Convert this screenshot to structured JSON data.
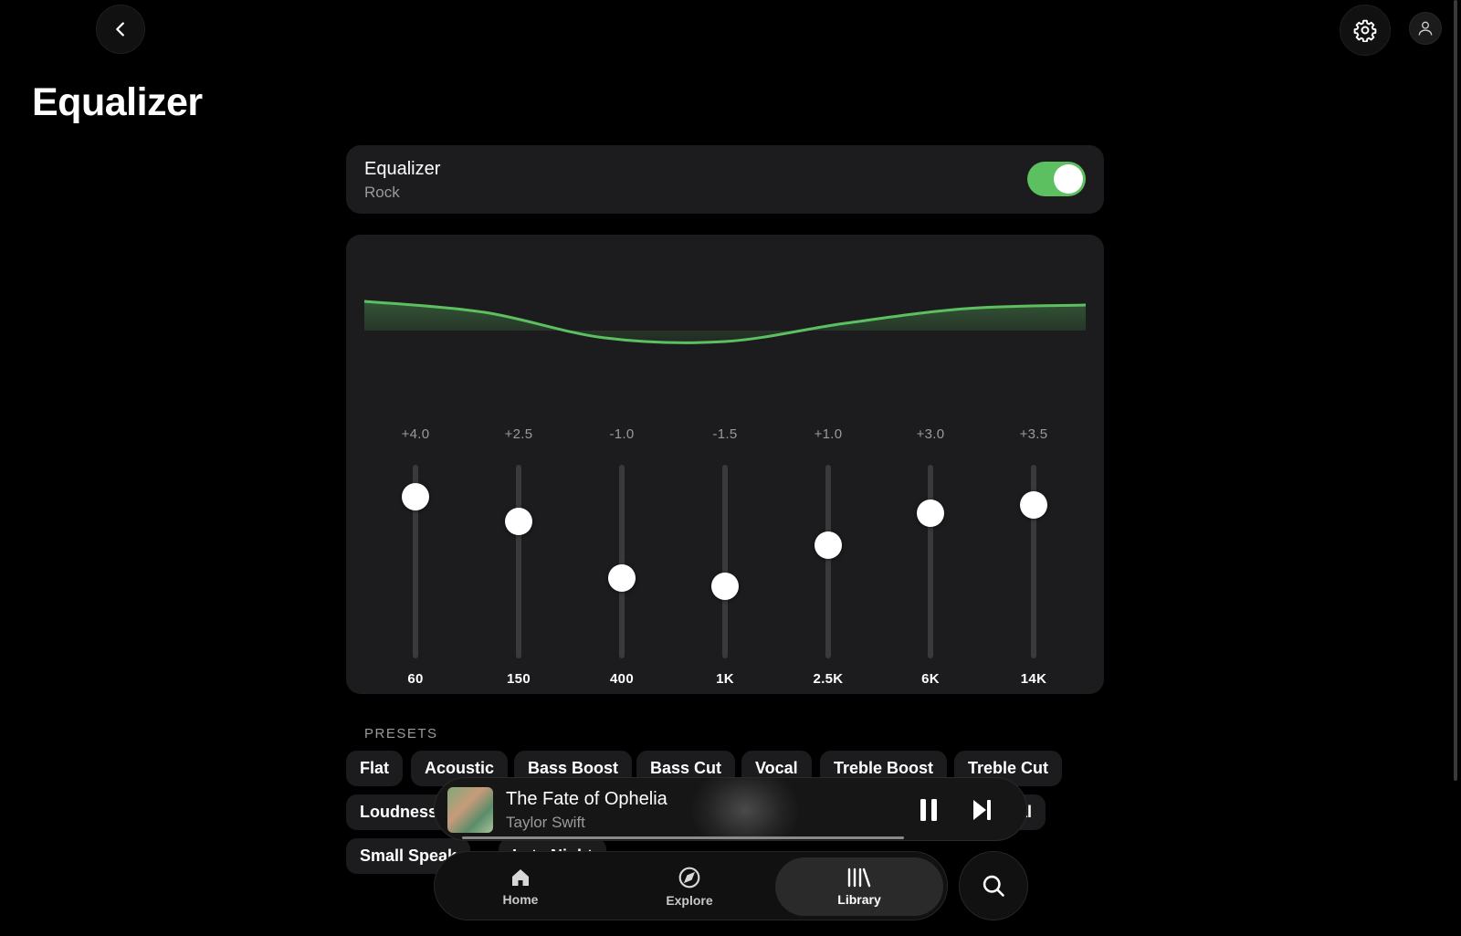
{
  "header": {
    "title": "Equalizer",
    "back_icon": "chevron-left-icon",
    "settings_icon": "gear-icon",
    "profile_icon": "user-icon"
  },
  "equalizer": {
    "card_title": "Equalizer",
    "preset_name": "Rock",
    "enabled": true,
    "accent_color": "#5cc060",
    "range_db": [
      -6,
      6
    ],
    "bands": [
      {
        "freq": "60",
        "value": "+4.0",
        "db": 4.0
      },
      {
        "freq": "150",
        "value": "+2.5",
        "db": 2.5
      },
      {
        "freq": "400",
        "value": "-1.0",
        "db": -1.0
      },
      {
        "freq": "1K",
        "value": "-1.5",
        "db": -1.5
      },
      {
        "freq": "2.5K",
        "value": "+1.0",
        "db": 1.0
      },
      {
        "freq": "6K",
        "value": "+3.0",
        "db": 3.0
      },
      {
        "freq": "14K",
        "value": "+3.5",
        "db": 3.5
      }
    ]
  },
  "presets": {
    "heading": "PRESETS",
    "items": [
      "Flat",
      "Acoustic",
      "Bass Boost",
      "Bass Cut",
      "Vocal",
      "Treble Boost",
      "Treble Cut",
      "Loudness",
      "al",
      "Small Speak",
      "Late Night"
    ]
  },
  "now_playing": {
    "title": "The Fate of Ophelia",
    "artist": "Taylor Swift",
    "progress": 0.82,
    "pause_icon": "pause-icon",
    "next_icon": "skip-next-icon"
  },
  "tabs": [
    {
      "label": "Home",
      "icon": "home-icon",
      "active": false
    },
    {
      "label": "Explore",
      "icon": "compass-icon",
      "active": false
    },
    {
      "label": "Library",
      "icon": "library-icon",
      "active": true
    }
  ],
  "search_icon": "search-icon"
}
